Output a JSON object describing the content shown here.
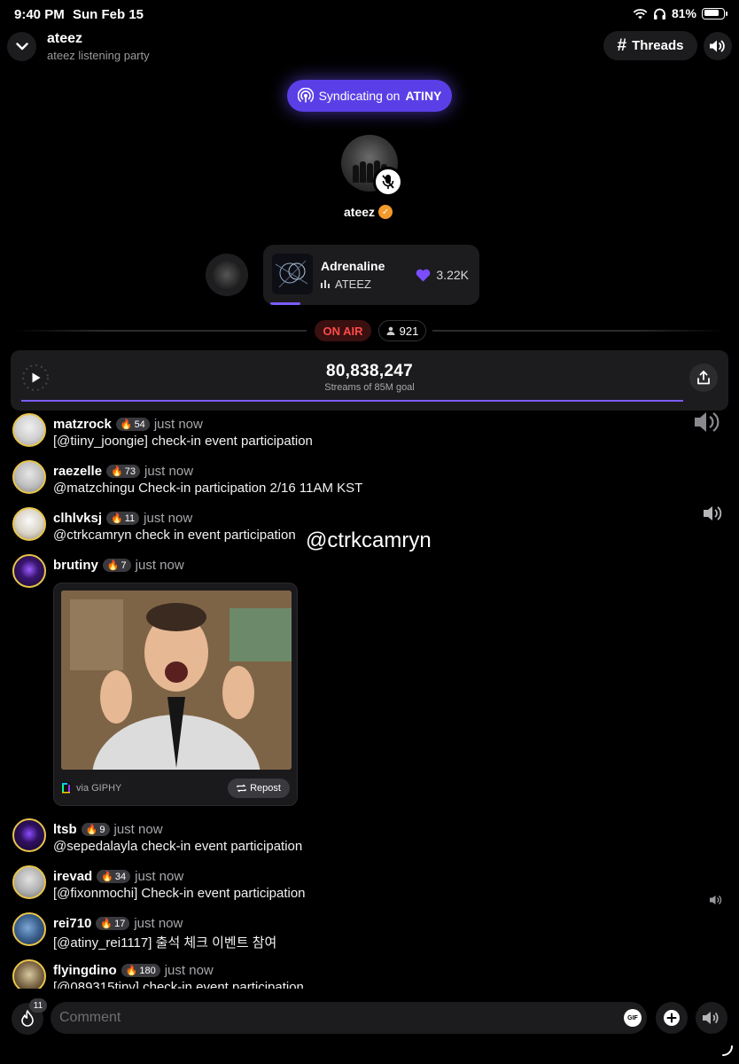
{
  "status_bar": {
    "time": "9:40 PM",
    "date": "Sun Feb 15",
    "battery": "81%",
    "battery_level": 0.81
  },
  "header": {
    "title": "ateez",
    "subtitle": "ateez listening party",
    "threads_label": "Threads"
  },
  "syndication": {
    "prefix": "Syndicating on",
    "target": "ATINY"
  },
  "host": {
    "name": "ateez"
  },
  "now_playing": {
    "title": "Adrenaline",
    "artist": "ATEEZ",
    "likes": "3.22K",
    "progress": 0.15
  },
  "live": {
    "status": "ON AIR",
    "listeners": "921"
  },
  "streams": {
    "count": "80,838,247",
    "label": "Streams of 85M goal",
    "progress": 0.951
  },
  "chat": {
    "messages": [
      {
        "user": "matzrock",
        "badge": "54",
        "time": "just now",
        "text": "[@tiiny_joongie] check-in event participation"
      },
      {
        "user": "raezelle",
        "badge": "73",
        "time": "just now",
        "text": "@matzchingu Check-in participation 2/16 11AM KST"
      },
      {
        "user": "clhlvksj",
        "badge": "11",
        "time": "just now",
        "text": "@ctrkcamryn check in event participation"
      },
      {
        "user": "brutiny",
        "badge": "7",
        "time": "just now",
        "text": ""
      },
      {
        "user": "ltsb",
        "badge": "9",
        "time": "just now",
        "text": "@sepedalayla check-in event participation"
      },
      {
        "user": "irevad",
        "badge": "34",
        "time": "just now",
        "text": "[@fixonmochi] Check-in event participation"
      },
      {
        "user": "rei710",
        "badge": "17",
        "time": "just now",
        "text": "[@atiny_rei1117] 출석 체크 이벤트 참여"
      },
      {
        "user": "flyingdino",
        "badge": "180",
        "time": "just now",
        "text": "[@089315tiny] check-in event participation"
      }
    ],
    "gif": {
      "via": "via GIPHY",
      "repost": "Repost"
    }
  },
  "overlay_handle": "@ctrkcamryn",
  "composer": {
    "placeholder": "Comment",
    "fire_count": "11",
    "gif_label": "GIF"
  },
  "colors": {
    "accent": "#6a4cff",
    "on_air": "#ff4a4a",
    "avatar_ring": "#e8c44a",
    "verified": "#f39a2b"
  }
}
